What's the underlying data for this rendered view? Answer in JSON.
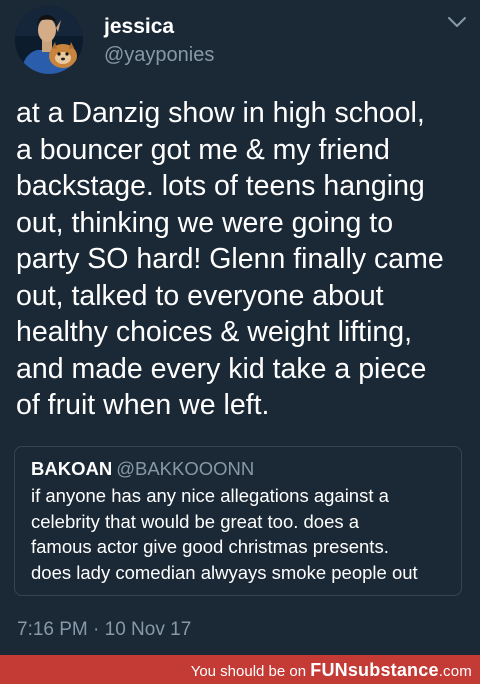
{
  "tweet": {
    "author": {
      "display_name": "jessica",
      "handle": "@yayponies",
      "avatar_icon": "avatar-spock-with-dog"
    },
    "menu_icon": "chevron-down-icon",
    "text_lines": [
      "at a Danzig show in high school,",
      "a bouncer got me & my friend",
      "backstage. lots of teens hanging",
      "out, thinking we were going to",
      "party SO hard! Glenn finally came",
      "out, talked to everyone about",
      "healthy choices & weight lifting,",
      "and made every kid take a piece",
      "of fruit when we left."
    ],
    "quoted_tweet": {
      "display_name": "BAKOAN",
      "handle": "@BAKKOOONN",
      "text_lines": [
        "if anyone has any nice allegations against a",
        "celebrity that would be great too. does a",
        "famous actor give good christmas presents.",
        "does lady comedian alwyays smoke people out"
      ]
    },
    "timestamp": "7:16 PM · 10 Nov 17"
  },
  "footer": {
    "prefix": "You should be on",
    "brand_bold": "FUNsubstance",
    "brand_suffix": ".com"
  },
  "colors": {
    "background": "#1b2836",
    "text_primary": "#ffffff",
    "text_secondary": "#8899a6",
    "quote_border": "#38444d",
    "footer_bar": "#c43a35"
  }
}
